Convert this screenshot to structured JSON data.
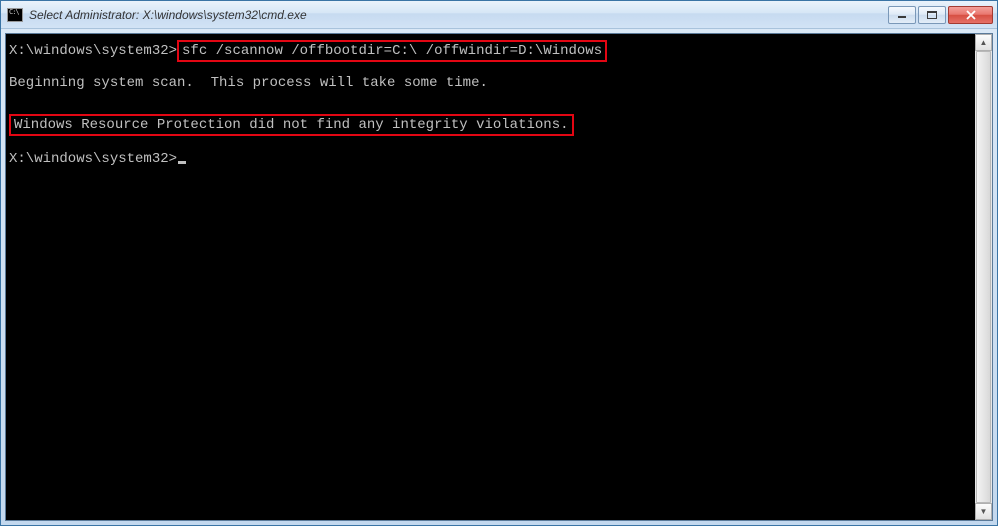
{
  "titlebar": {
    "icon_tag": "C:\\",
    "title": "Select Administrator: X:\\windows\\system32\\cmd.exe"
  },
  "terminal": {
    "prompt1_prefix": "X:\\windows\\system32>",
    "command1": "sfc /scannow /offbootdir=C:\\ /offwindir=D:\\Windows",
    "status": "Beginning system scan.  This process will take some time.",
    "result": "Windows Resource Protection did not find any integrity violations.",
    "prompt2": "X:\\windows\\system32>"
  },
  "controls": {
    "minimize": "minimize",
    "maximize": "maximize",
    "close": "close"
  },
  "scrollbar": {
    "up": "▲",
    "down": "▼"
  }
}
